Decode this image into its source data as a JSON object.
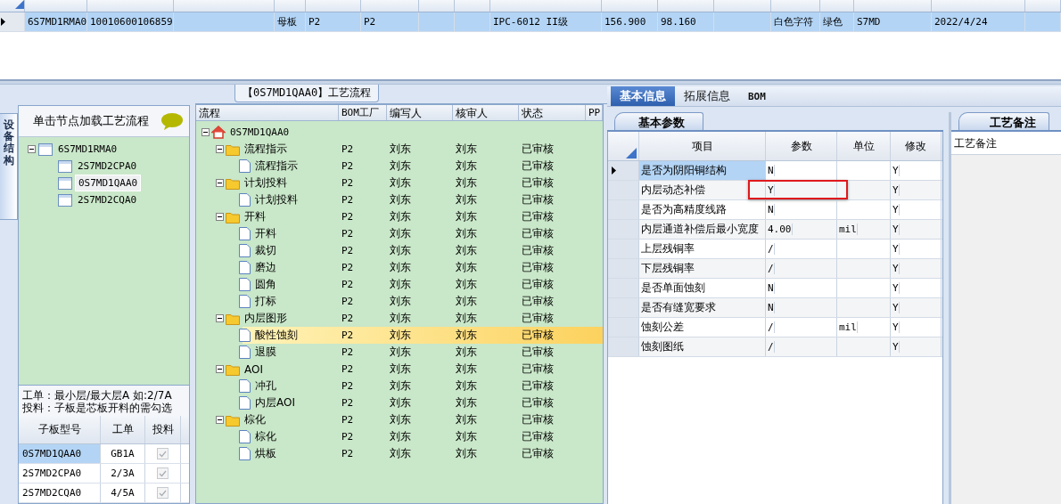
{
  "top_grid": {
    "rows": [
      {
        "selected": true,
        "cells": [
          "6S7MD1RMA0",
          "10010600106859",
          null,
          "母板",
          "P2",
          "P2",
          null,
          null,
          "IPC-6012 II级",
          "156.900",
          "98.160",
          null,
          "白色字符",
          "绿色",
          "S7MD",
          "2022/4/24",
          null
        ]
      }
    ]
  },
  "side_tab": {
    "label": "设备结构"
  },
  "structure_panel": {
    "header": "单击节点加载工艺流程",
    "tree": [
      {
        "label": "6S7MD1RMA0",
        "selected": false,
        "expanded": true,
        "children": [
          {
            "label": "2S7MD2CPA0",
            "selected": false
          },
          {
            "label": "0S7MD1QAA0",
            "selected": true
          },
          {
            "label": "2S7MD2CQA0",
            "selected": false
          }
        ]
      }
    ],
    "notes": [
      "工单：最小层/最大层A 如:2/7A",
      "投料：子板是芯板开料的需勾选"
    ],
    "sub_grid": {
      "columns": [
        "子板型号",
        "工单",
        "投料"
      ],
      "rows": [
        {
          "model": "0S7MD1QAA0",
          "order": "GB1A",
          "feed": true,
          "selected": true
        },
        {
          "model": "2S7MD2CPA0",
          "order": "2/3A",
          "feed": true,
          "selected": false
        },
        {
          "model": "2S7MD2CQA0",
          "order": "4/5A",
          "feed": true,
          "selected": false
        }
      ]
    }
  },
  "process_panel": {
    "title": "【0S7MD1QAA0】工艺流程",
    "columns": [
      "流程",
      "BOM工厂",
      "编写人",
      "核审人",
      "状态",
      "PP"
    ],
    "tree": [
      {
        "kind": "root",
        "label": "0S7MD1QAA0",
        "selected": false,
        "expanded": true,
        "children": [
          {
            "kind": "group",
            "label": "流程指示",
            "bom": "P2",
            "writer": "刘东",
            "reviewer": "刘东",
            "status": "已审核",
            "selected": false,
            "expanded": true,
            "children": [
              {
                "kind": "step",
                "label": "流程指示",
                "bom": "P2",
                "writer": "刘东",
                "reviewer": "刘东",
                "status": "已审核",
                "selected": false
              }
            ]
          },
          {
            "kind": "group",
            "label": "计划投料",
            "bom": "P2",
            "writer": "刘东",
            "reviewer": "刘东",
            "status": "已审核",
            "selected": false,
            "expanded": true,
            "children": [
              {
                "kind": "step",
                "label": "计划投料",
                "bom": "P2",
                "writer": "刘东",
                "reviewer": "刘东",
                "status": "已审核",
                "selected": false
              }
            ]
          },
          {
            "kind": "group",
            "label": "开料",
            "bom": "P2",
            "writer": "刘东",
            "reviewer": "刘东",
            "status": "已审核",
            "selected": false,
            "expanded": true,
            "children": [
              {
                "kind": "step",
                "label": "开料",
                "bom": "P2",
                "writer": "刘东",
                "reviewer": "刘东",
                "status": "已审核",
                "selected": false
              },
              {
                "kind": "step",
                "label": "裁切",
                "bom": "P2",
                "writer": "刘东",
                "reviewer": "刘东",
                "status": "已审核",
                "selected": false
              },
              {
                "kind": "step",
                "label": "磨边",
                "bom": "P2",
                "writer": "刘东",
                "reviewer": "刘东",
                "status": "已审核",
                "selected": false
              },
              {
                "kind": "step",
                "label": "圆角",
                "bom": "P2",
                "writer": "刘东",
                "reviewer": "刘东",
                "status": "已审核",
                "selected": false
              },
              {
                "kind": "step",
                "label": "打标",
                "bom": "P2",
                "writer": "刘东",
                "reviewer": "刘东",
                "status": "已审核",
                "selected": false
              }
            ]
          },
          {
            "kind": "group",
            "label": "内层图形",
            "bom": "P2",
            "writer": "刘东",
            "reviewer": "刘东",
            "status": "已审核",
            "selected": false,
            "expanded": true,
            "children": [
              {
                "kind": "step",
                "label": "酸性蚀刻",
                "bom": "P2",
                "writer": "刘东",
                "reviewer": "刘东",
                "status": "已审核",
                "selected": true
              },
              {
                "kind": "step",
                "label": "退膜",
                "bom": "P2",
                "writer": "刘东",
                "reviewer": "刘东",
                "status": "已审核",
                "selected": false
              }
            ]
          },
          {
            "kind": "group",
            "label": "AOI",
            "bom": "P2",
            "writer": "刘东",
            "reviewer": "刘东",
            "status": "已审核",
            "selected": false,
            "expanded": true,
            "children": [
              {
                "kind": "step",
                "label": "冲孔",
                "bom": "P2",
                "writer": "刘东",
                "reviewer": "刘东",
                "status": "已审核",
                "selected": false
              },
              {
                "kind": "step",
                "label": "内层AOI",
                "bom": "P2",
                "writer": "刘东",
                "reviewer": "刘东",
                "status": "已审核",
                "selected": false
              }
            ]
          },
          {
            "kind": "group",
            "label": "棕化",
            "bom": "P2",
            "writer": "刘东",
            "reviewer": "刘东",
            "status": "已审核",
            "selected": false,
            "expanded": true,
            "children": [
              {
                "kind": "step",
                "label": "棕化",
                "bom": "P2",
                "writer": "刘东",
                "reviewer": "刘东",
                "status": "已审核",
                "selected": false
              },
              {
                "kind": "step",
                "label": "烘板",
                "bom": "P2",
                "writer": "刘东",
                "reviewer": "刘东",
                "status": "已审核",
                "selected": false
              }
            ]
          }
        ]
      }
    ]
  },
  "info_tabs": [
    {
      "label": "基本信息",
      "selected": true
    },
    {
      "label": "拓展信息",
      "selected": false
    },
    {
      "label": "BOM",
      "selected": false
    }
  ],
  "params": {
    "tab": "基本参数",
    "columns": [
      "项目",
      "参数",
      "单位",
      "修改"
    ],
    "rows": [
      {
        "item": "是否为阴阳铜结构",
        "value": "N",
        "modify": "Y",
        "current": true,
        "highlighted": false
      },
      {
        "item": "内层动态补偿",
        "value": "Y",
        "modify": "Y",
        "current": false,
        "highlighted": true
      },
      {
        "item": "是否为高精度线路",
        "value": "N",
        "modify": "Y",
        "current": false,
        "highlighted": false
      },
      {
        "item": "内层通道补偿后最小宽度",
        "value": "4.00",
        "unit": "mil",
        "modify": "Y",
        "current": false,
        "highlighted": false
      },
      {
        "item": "上层残铜率",
        "value": "/",
        "modify": "Y",
        "current": false,
        "highlighted": false
      },
      {
        "item": "下层残铜率",
        "value": "/",
        "modify": "Y",
        "current": false,
        "highlighted": false
      },
      {
        "item": "是否单面蚀刻",
        "value": "N",
        "modify": "Y",
        "current": false,
        "highlighted": false
      },
      {
        "item": "是否有缝宽要求",
        "value": "N",
        "modify": "Y",
        "current": false,
        "highlighted": false
      },
      {
        "item": "蚀刻公差",
        "value": "/",
        "unit": "mil",
        "modify": "Y",
        "current": false,
        "highlighted": false
      },
      {
        "item": "蚀刻图纸",
        "value": "/",
        "modify": "Y",
        "current": false,
        "highlighted": false
      }
    ]
  },
  "notes_panel": {
    "tab": "工艺备注",
    "label": "工艺备注"
  }
}
